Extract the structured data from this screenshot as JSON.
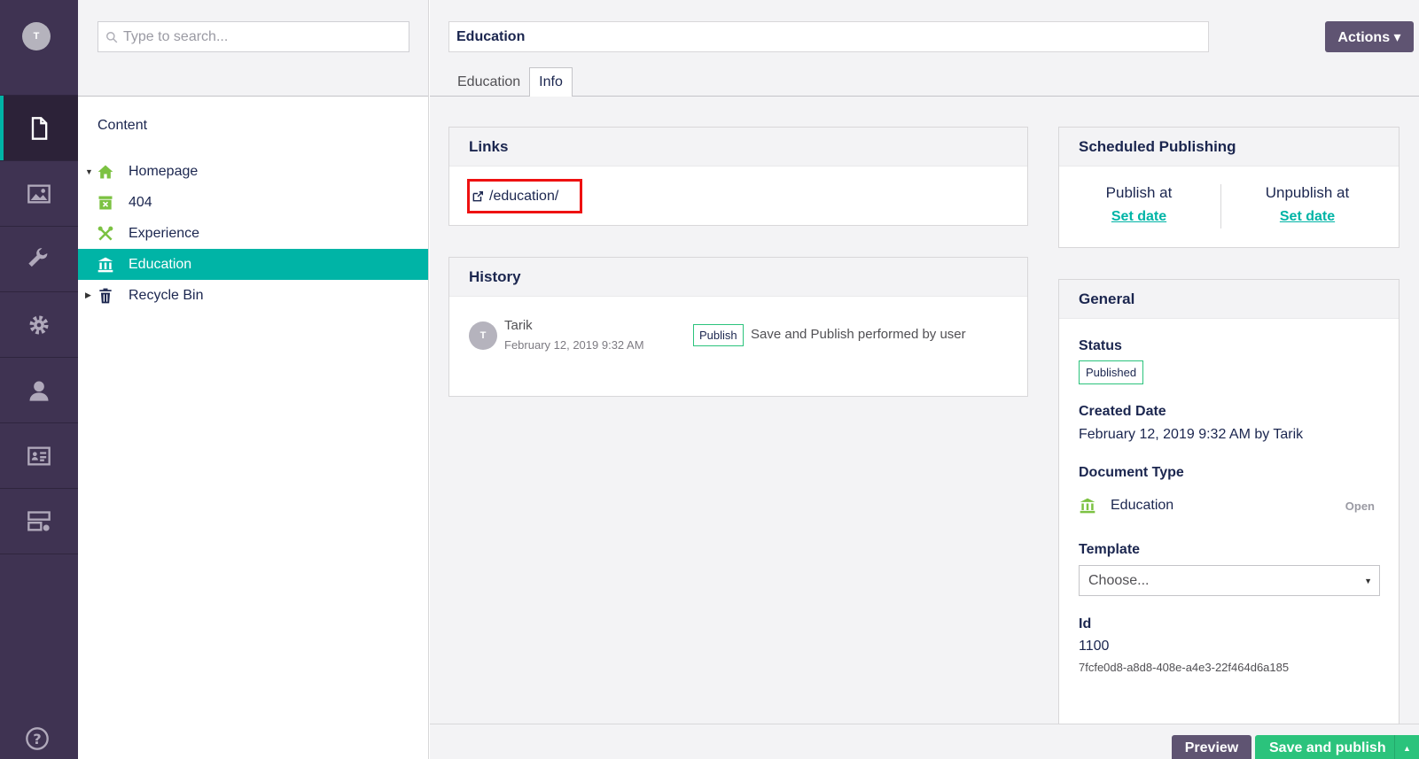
{
  "rail": {
    "avatar_initial": "T",
    "sections": [
      {
        "name": "content",
        "icon": "document-icon",
        "active": true
      },
      {
        "name": "media",
        "icon": "image-icon"
      },
      {
        "name": "settings",
        "icon": "wrench-icon"
      },
      {
        "name": "packages",
        "icon": "gear-icon"
      },
      {
        "name": "users",
        "icon": "user-icon"
      },
      {
        "name": "members",
        "icon": "id-card-icon"
      },
      {
        "name": "forms",
        "icon": "forms-icon"
      }
    ],
    "help_icon": "help-icon"
  },
  "tree": {
    "search_placeholder": "Type to search...",
    "title": "Content",
    "items": [
      {
        "label": "Homepage",
        "icon": "home-icon",
        "caret": "▼"
      },
      {
        "label": "404",
        "icon": "box-x-icon"
      },
      {
        "label": "Experience",
        "icon": "tools-icon"
      },
      {
        "label": "Education",
        "icon": "museum-icon",
        "active": true
      },
      {
        "label": "Recycle Bin",
        "icon": "trash-icon",
        "caret": "▶"
      }
    ]
  },
  "header": {
    "name_value": "Education",
    "actions_label": "Actions ▾",
    "tabs": [
      {
        "label": "Education"
      },
      {
        "label": "Info",
        "active": true
      }
    ]
  },
  "links": {
    "title": "Links",
    "url": "/education/"
  },
  "history": {
    "title": "History",
    "avatar_initial": "T",
    "user": "Tarik",
    "date": "February 12, 2019 9:32 AM",
    "badge": "Publish",
    "message": "Save and Publish performed by user"
  },
  "scheduled": {
    "title": "Scheduled Publishing",
    "publish_label": "Publish at",
    "publish_value": "Set date",
    "unpublish_label": "Unpublish at",
    "unpublish_value": "Set date"
  },
  "general": {
    "title": "General",
    "status_label": "Status",
    "status_value": "Published",
    "created_label": "Created Date",
    "created_value": "February 12, 2019 9:32 AM by Tarik",
    "doctype_label": "Document Type",
    "doctype_value": "Education",
    "doctype_open": "Open",
    "template_label": "Template",
    "template_value": "Choose...",
    "id_label": "Id",
    "id_value": "1100",
    "guid": "7fcfe0d8-a8d8-408e-a4e3-22f464d6a185"
  },
  "footer": {
    "preview_label": "Preview",
    "save_label": "Save and publish",
    "save_caret": "▲"
  },
  "colors": {
    "rail_bg": "#3f3352",
    "accent": "#00b4a6",
    "success": "#2bc37c",
    "button_dark": "#5f5472"
  }
}
